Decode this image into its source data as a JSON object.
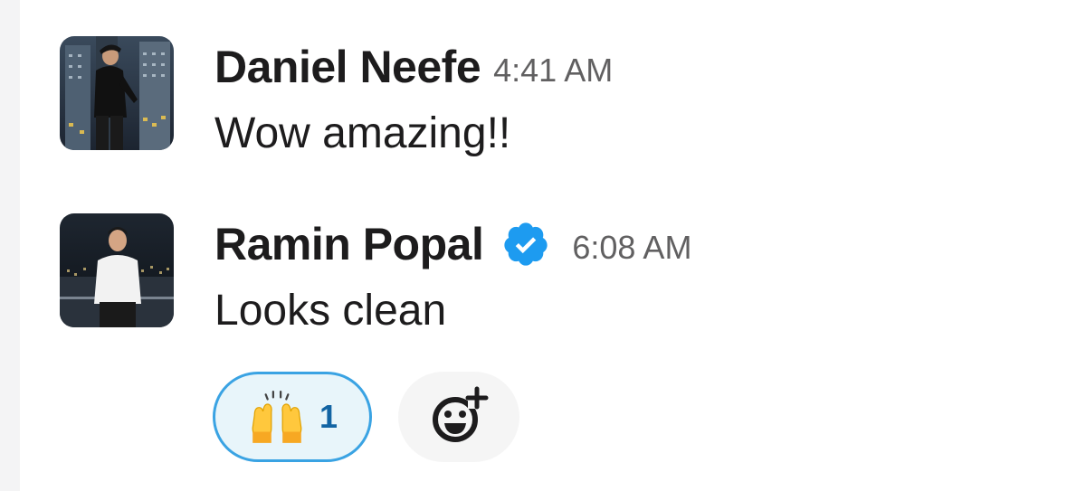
{
  "messages": [
    {
      "sender": "Daniel Neefe",
      "time": "4:41 AM",
      "text": "Wow amazing!!",
      "avatar_icon": "person-night-city-avatar"
    },
    {
      "sender": "Ramin Popal",
      "verified": true,
      "time": "6:08 AM",
      "text": "Looks clean",
      "avatar_icon": "person-white-shirt-avatar",
      "reactions": [
        {
          "emoji": "raising-hands-emoji",
          "count": "1"
        }
      ]
    }
  ],
  "add_reaction_icon": "add-emoji-icon",
  "colors": {
    "reaction_border": "#3aa3e3",
    "reaction_count": "#1264a3",
    "verified_badge": "#1d9bf0"
  }
}
